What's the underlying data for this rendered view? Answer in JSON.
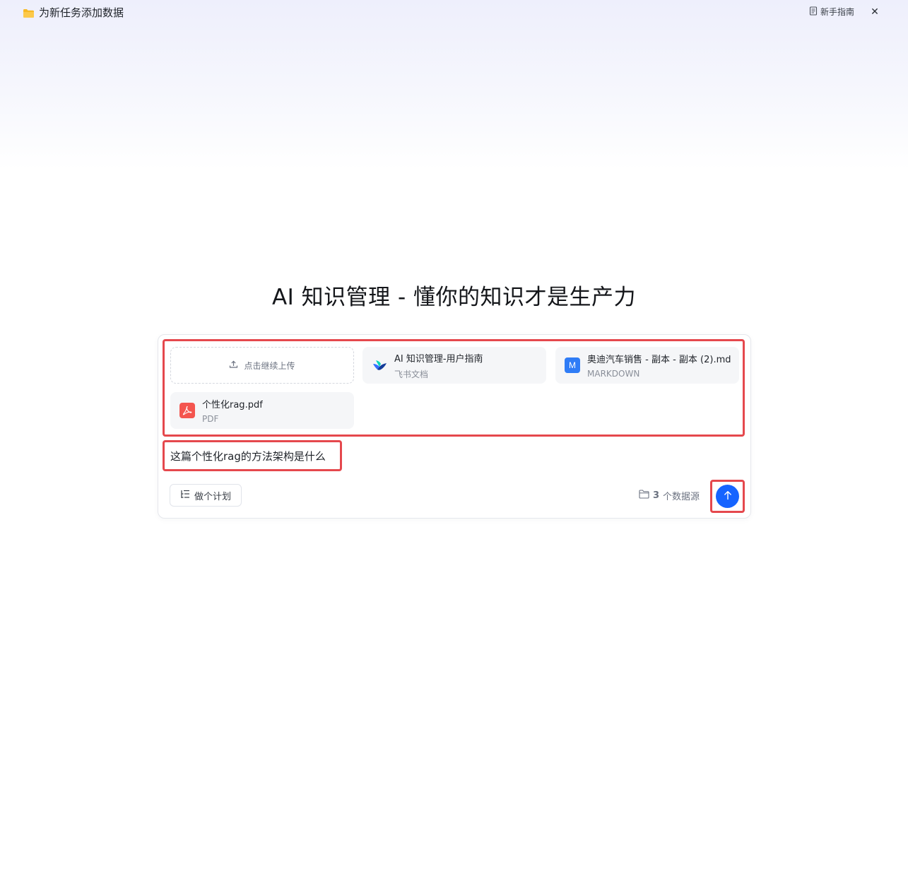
{
  "topbar": {
    "title": "为新任务添加数据",
    "guide_label": "新手指南",
    "folder_icon": "folder-icon",
    "close_icon": "close-icon"
  },
  "headline": "AI 知识管理 - 懂你的知识才是生产力",
  "upload": {
    "label": "点击继续上传"
  },
  "files": [
    {
      "name": "AI 知识管理-用户指南",
      "type": "飞书文档",
      "icon": "feishu-doc-icon"
    },
    {
      "name": "奥迪汽车销售 - 副本 - 副本 (2).md",
      "type": "MARKDOWN",
      "icon": "markdown-icon",
      "icon_letter": "M"
    },
    {
      "name": "个性化rag.pdf",
      "type": "PDF",
      "icon": "pdf-icon"
    }
  ],
  "query": "这篇个性化rag的方法架构是什么",
  "plan_button": "做个计划",
  "sources": {
    "count": "3",
    "label": "个数据源"
  },
  "colors": {
    "accent": "#1664ff",
    "highlight": "#e5484d",
    "pdf": "#f4554f",
    "markdown": "#2f7cf6",
    "folder": "#f7b924"
  }
}
